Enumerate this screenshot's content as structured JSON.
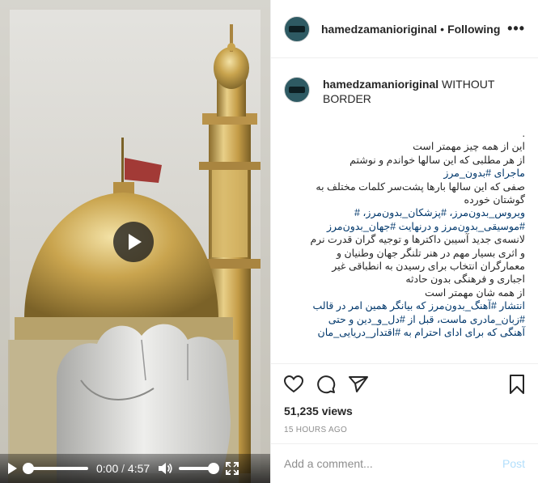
{
  "video": {
    "current_time": "0:00",
    "separator": "/",
    "duration": "4:57",
    "progress": 0,
    "volume": 1
  },
  "header": {
    "username": "hamedzamanioriginal",
    "dot": "•",
    "follow_status": "Following",
    "more_label": "•••"
  },
  "caption": {
    "username": "hamedzamanioriginal",
    "title": "WITHOUT BORDER",
    "lines": [
      {
        "text": "."
      },
      {
        "text": "این از همه چیز مهمتر است"
      },
      {
        "text": "از هر مطلبی که این سالها خواندم و نوشتم"
      },
      {
        "text": "ماجرای #بدون_مرز"
      },
      {
        "text": "صفی که این سالها بارها پشت‌سر کلمات مختلف به"
      },
      {
        "text": "گوشتان خورده"
      },
      {
        "text": "ویروس_بدون‌مرز، #پزشکان_بدون‌مرز، #"
      },
      {
        "text": "#موسیقی_بدون‌مرز و درنهایت #جهان_بدون‌مرز"
      },
      {
        "text": "لانسه‌ی جدید آسیبن داکترها و توجیه گران قدرت نرم"
      },
      {
        "text": "و اثری بسیار مهم در هنر تلنگر جهان وطنیان و"
      },
      {
        "text": "معمارگران انتخاب برای رسیدن به انطباقی غیر"
      },
      {
        "text": "اجباری و فرهنگی بدون حادثه"
      },
      {
        "text": "از همه شان مهمتر است"
      },
      {
        "text": "انتشار #آهنگ_بدون‌مرز که بیانگر همین امر در قالب"
      },
      {
        "text": "#زبان_مادری ماست، قبل از #دل_و_دین و حتی"
      },
      {
        "text": "آهنگی که برای ادای احترام به #اقتدار_دریایی_مان"
      }
    ]
  },
  "actions": {
    "views": "51,235 views",
    "timestamp": "15 HOURS AGO"
  },
  "comment_box": {
    "placeholder": "Add a comment...",
    "post_label": "Post"
  },
  "colors": {
    "link": "#00376b",
    "post_disabled": "#b2dffc",
    "muted": "#8e8e8e"
  }
}
